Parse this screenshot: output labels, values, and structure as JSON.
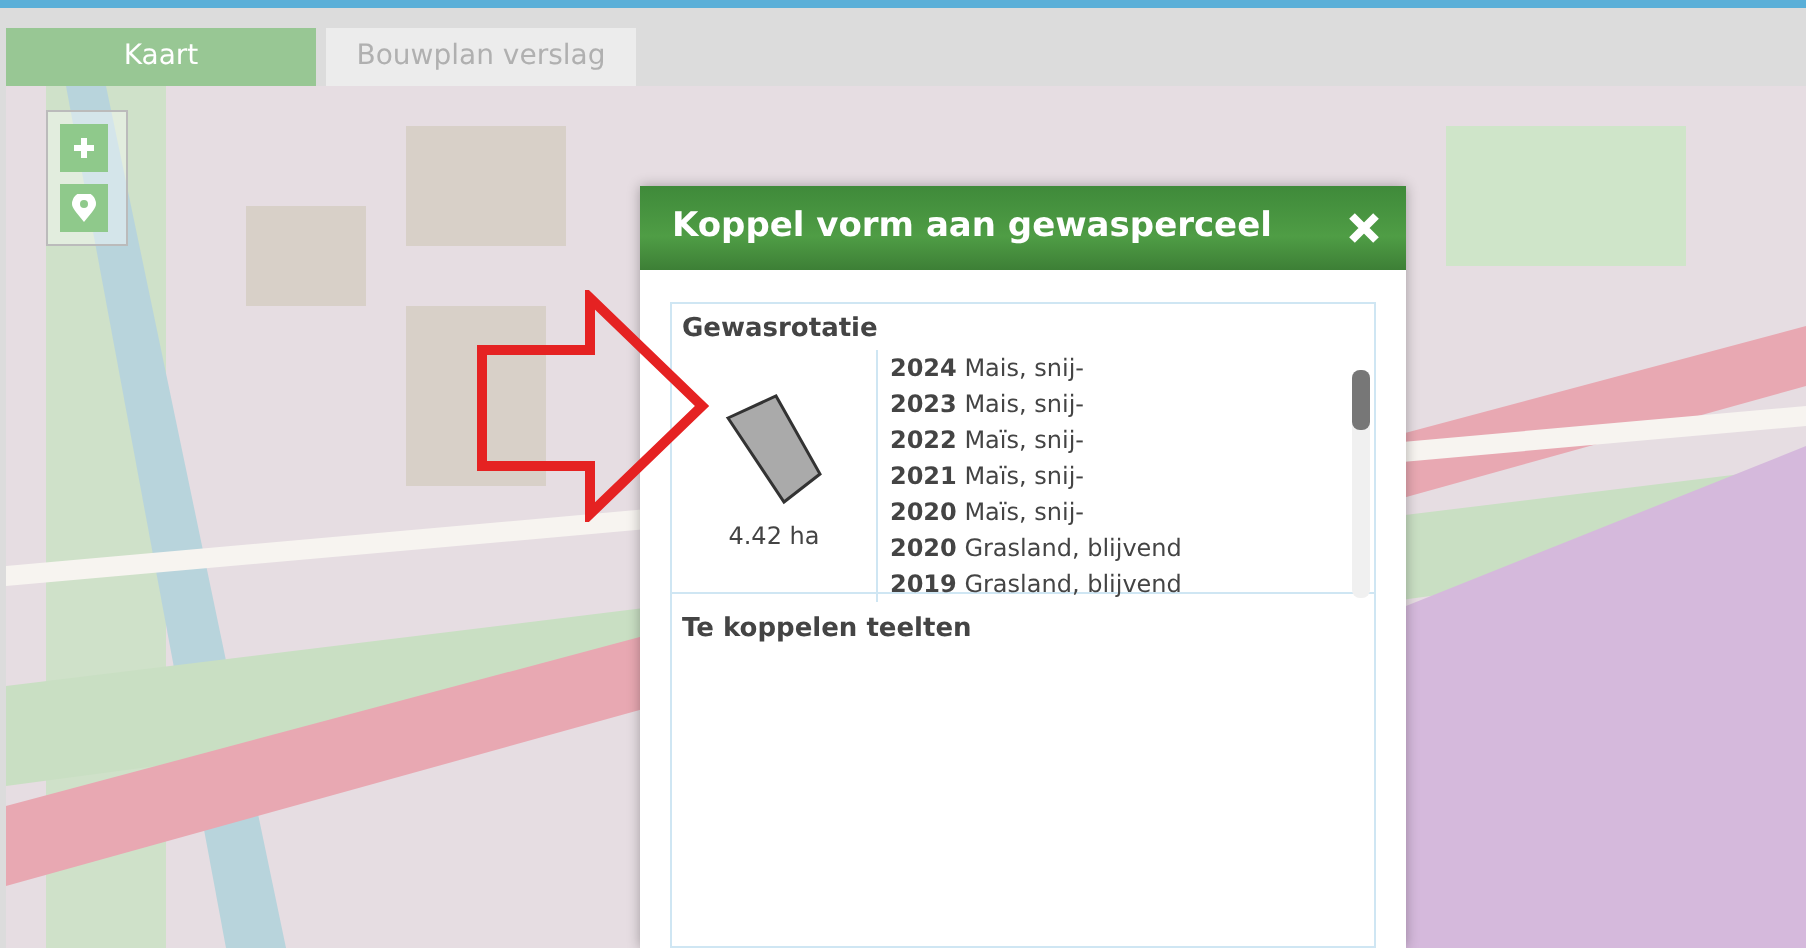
{
  "tabs": [
    {
      "label": "Kaart",
      "selected": true
    },
    {
      "label": "Bouwplan verslag",
      "selected": false
    }
  ],
  "dialog": {
    "title": "Koppel vorm aan gewasperceel",
    "rotation": {
      "heading": "Gewasrotatie",
      "area": "4.42 ha",
      "entries": [
        {
          "year": "2024",
          "crop": "Mais, snij-"
        },
        {
          "year": "2023",
          "crop": "Mais, snij-"
        },
        {
          "year": "2022",
          "crop": "Maïs, snij-"
        },
        {
          "year": "2021",
          "crop": "Maïs, snij-"
        },
        {
          "year": "2020",
          "crop": "Maïs, snij-"
        },
        {
          "year": "2020",
          "crop": "Grasland, blijvend"
        },
        {
          "year": "2019",
          "crop": "Grasland, blijvend"
        }
      ]
    },
    "linking": {
      "heading": "Te koppelen teelten"
    }
  }
}
